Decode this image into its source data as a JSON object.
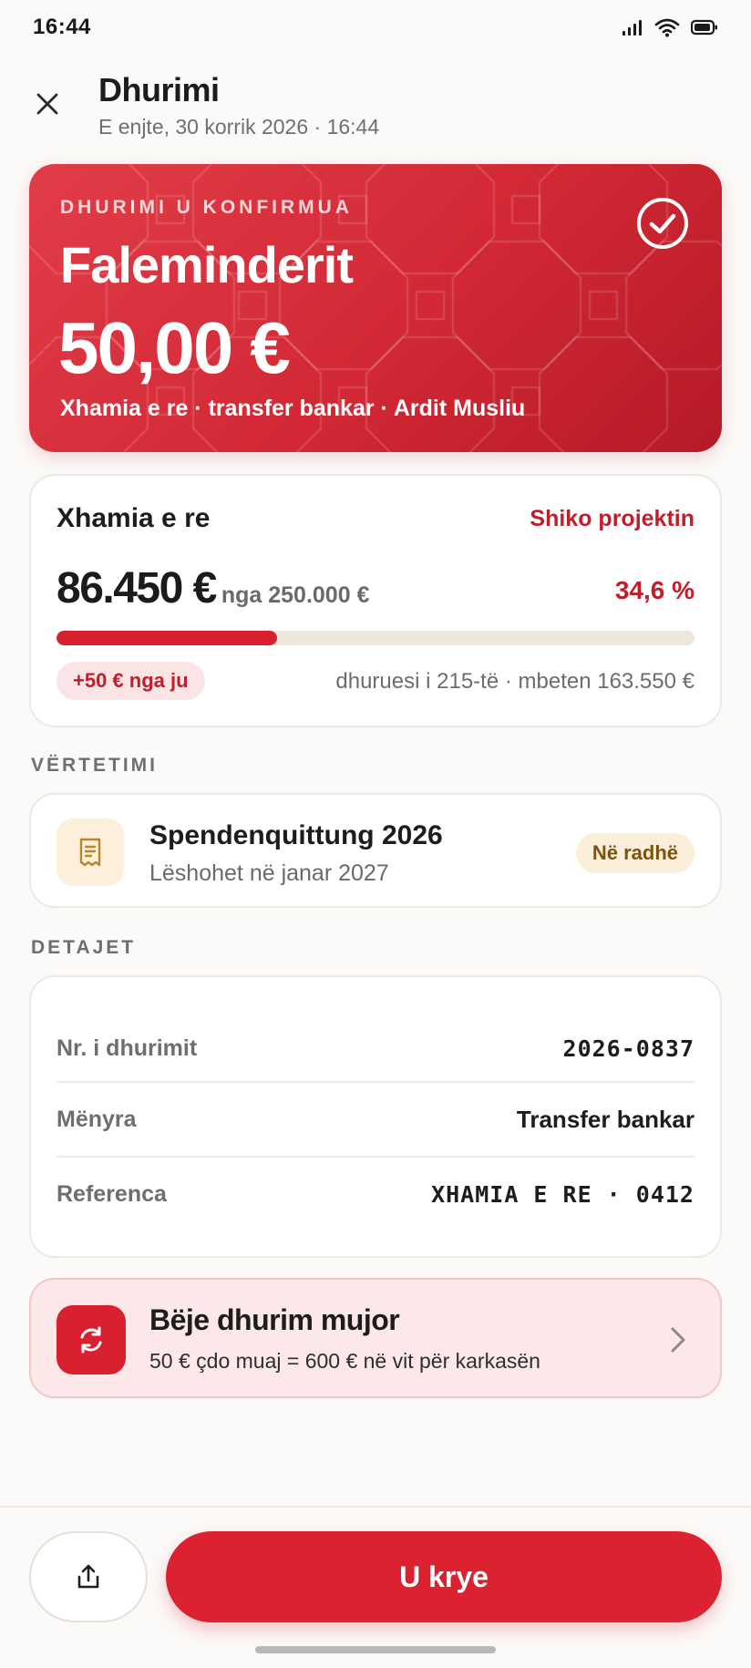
{
  "status_bar": {
    "time": "16:44"
  },
  "header": {
    "title": "Dhurimi",
    "subtitle": "E enjte, 30 korrik 2026 · 16:44"
  },
  "hero": {
    "kicker": "DHURIMI U KONFIRMUA",
    "title": "Faleminderit",
    "amount": "50,00 €",
    "meta": "Xhamia e re · transfer bankar · Ardit Musliu"
  },
  "project": {
    "name": "Xhamia e re",
    "link_label": "Shiko projektin",
    "raised": "86.450 €",
    "goal": "nga 250.000 €",
    "percent": "34,6 %",
    "progress_fraction": 0.346,
    "your_contribution": "+50 € nga ju",
    "donor_meta": "dhuruesi i 215-të · mbeten 163.550 €"
  },
  "receipt_section": {
    "label": "VËRTETIMI",
    "title": "Spendenquittung 2026",
    "subtitle": "Lëshohet në janar 2027",
    "status": "Në radhë"
  },
  "details_section": {
    "label": "DETAJET",
    "rows": [
      {
        "label": "Nr. i dhurimit",
        "value": "2026-0837"
      },
      {
        "label": "Mënyra",
        "value": "Transfer bankar"
      },
      {
        "label": "Referenca",
        "value": "XHAMIA E RE · 0412"
      }
    ]
  },
  "monthly": {
    "title": "Bëje dhurim mujor",
    "subtitle": "50 € çdo muaj = 600 € në vit për karkasën"
  },
  "footer": {
    "done_label": "U krye"
  },
  "colors": {
    "accent": "#dc2230",
    "accent_text": "#c11d2b",
    "amber_text": "#7a5410",
    "background": "#fbfaf8"
  },
  "icons": {
    "close": "close-icon",
    "check": "check-circle-icon",
    "receipt": "receipt-icon",
    "repeat": "repeat-icon",
    "chevron": "chevron-right-icon",
    "share": "share-icon"
  }
}
